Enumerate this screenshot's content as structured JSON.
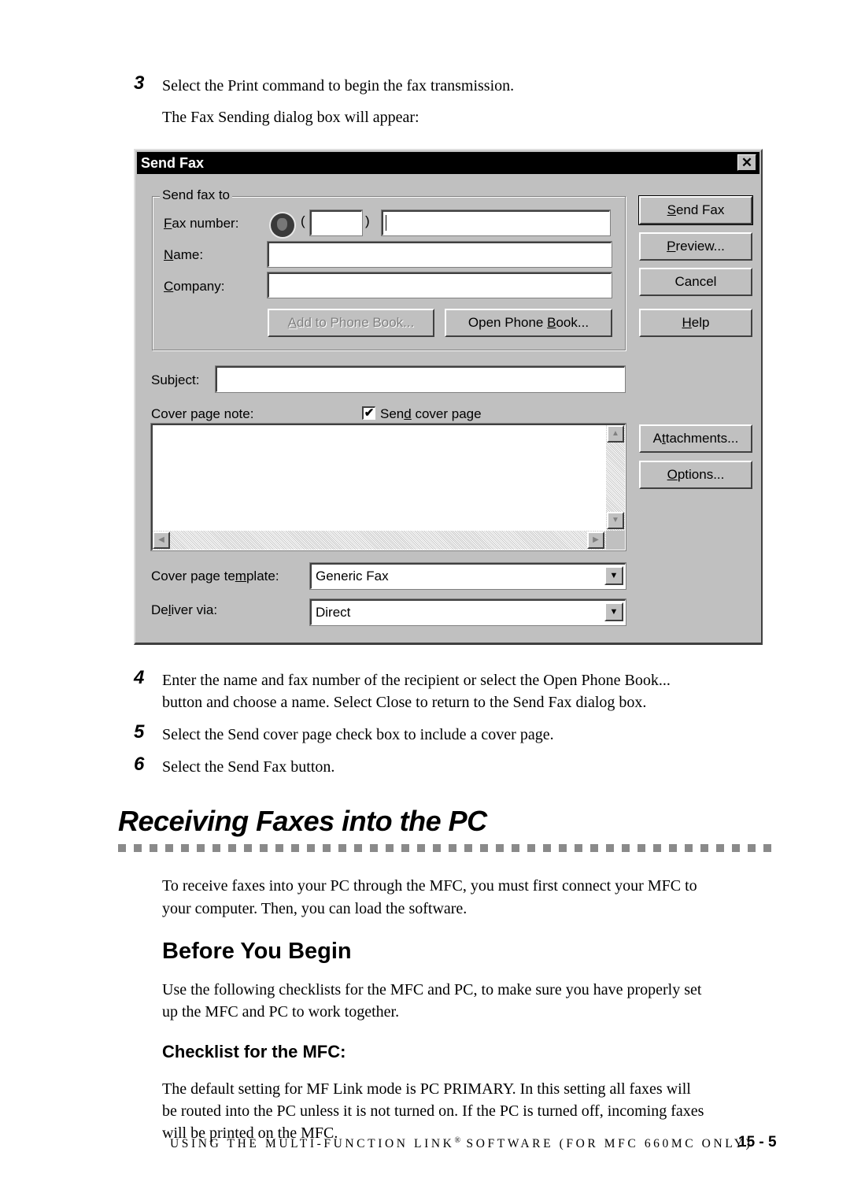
{
  "steps_before": [
    {
      "number": "3",
      "text": "Select the Print command to begin the fax transmission.",
      "subtext": "The Fax Sending dialog box will appear:"
    }
  ],
  "dialog": {
    "title": "Send Fax",
    "close_icon": "close-icon",
    "group_label": "Send fax to",
    "fax_number_label": "Fax number:",
    "fax_number_label_accel": "F",
    "fax_number_label_rest": "ax number:",
    "globe_icon": "globe-icon",
    "open_paren": "(",
    "close_paren": ")",
    "area_code_value": "",
    "fax_number_value": "",
    "name_label_accel": "N",
    "name_label_rest": "ame:",
    "name_value": "",
    "company_label_accel": "C",
    "company_label_rest": "ompany:",
    "company_value": "",
    "add_to_phonebook_accel": "A",
    "add_to_phonebook_rest": "dd to Phone Book...",
    "open_phonebook_pre": "Open Phone ",
    "open_phonebook_accel": "B",
    "open_phonebook_post": "ook...",
    "subject_label": "Subject:",
    "subject_value": "",
    "cover_note_label": "Cover page note:",
    "send_cover_checked": true,
    "send_cover_pre": "Sen",
    "send_cover_accel": "d",
    "send_cover_post": " cover page",
    "cover_note_value": "",
    "template_label_pre": "Cover page te",
    "template_label_accel": "m",
    "template_label_post": "plate:",
    "template_value": "Generic Fax",
    "deliver_label_pre": "De",
    "deliver_label_accel": "l",
    "deliver_label_post": "iver via:",
    "deliver_value": "Direct",
    "buttons": {
      "send_fax_accel": "S",
      "send_fax_rest": "end Fax",
      "preview_accel": "P",
      "preview_rest": "review...",
      "cancel": "Cancel",
      "help_accel": "H",
      "help_rest": "elp",
      "attachments_pre": "A",
      "attachments_accel": "t",
      "attachments_post": "tachments...",
      "options_accel": "O",
      "options_rest": "ptions..."
    }
  },
  "steps_after": [
    {
      "number": "4",
      "line1": "Enter the name and fax number of the recipient or select the Open Phone Book...",
      "line2": "button and choose a name.  Select Close to return to the Send Fax dialog box."
    },
    {
      "number": "5",
      "line1": "Select the Send cover page check box to include a cover page."
    },
    {
      "number": "6",
      "line1": "Select the Send Fax button."
    }
  ],
  "section": {
    "title": "Receiving Faxes into the PC",
    "intro_line1": "To receive faxes into your PC through the MFC, you must first connect your MFC to",
    "intro_line2": "your computer. Then, you can load the software.",
    "subsection_title": "Before You Begin",
    "sub_line1": "Use the following checklists for the MFC and PC, to make sure you have properly set",
    "sub_line2": "up the MFC and PC to work together.",
    "checklist_title": "Checklist for the MFC:",
    "check_line1": "The default setting for MF Link mode is PC PRIMARY. In this setting all faxes will",
    "check_line2": "be routed into the PC unless it is not turned on. If the PC is turned off, incoming faxes",
    "check_line3": "will be printed on the MFC."
  },
  "footer": {
    "running_title_pre": "USING THE MULTI-FUNCTION LINK",
    "registered": "®",
    "running_title_post": " SOFTWARE (FOR MFC 660MC ONLY)",
    "page_number": "15 - 5"
  }
}
